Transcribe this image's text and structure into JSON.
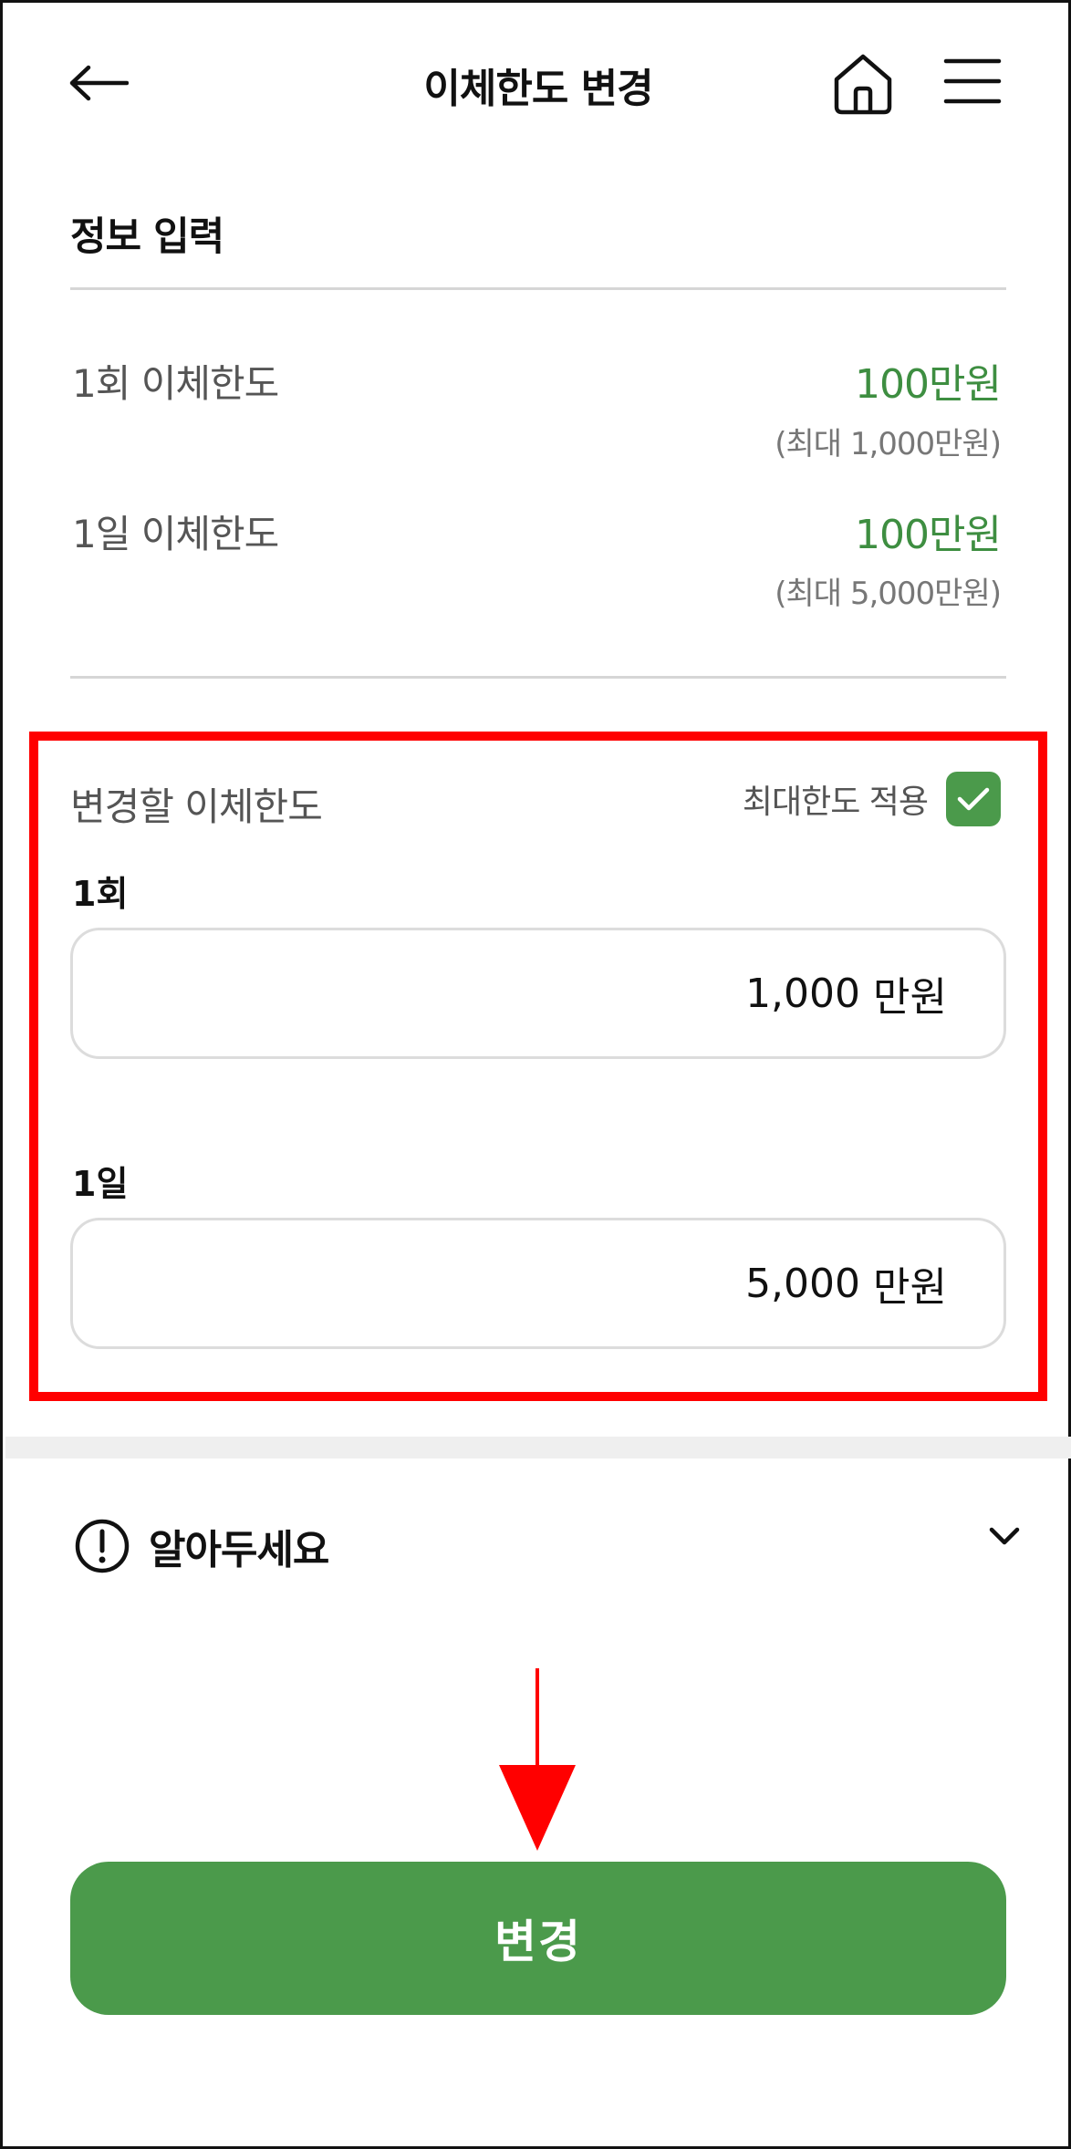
{
  "header": {
    "title": "이체한도 변경",
    "back_icon": "arrow-left-icon",
    "home_icon": "home-icon",
    "menu_icon": "hamburger-menu-icon"
  },
  "info": {
    "section_title": "정보 입력",
    "rows": [
      {
        "label": "1회 이체한도",
        "value": "100만원",
        "sub": "(최대 1,000만원)"
      },
      {
        "label": "1일 이체한도",
        "value": "100만원",
        "sub": "(최대 5,000만원)"
      }
    ]
  },
  "change_limit": {
    "title": "변경할 이체한도",
    "max_apply_label": "최대한도 적용",
    "max_apply_checked": true,
    "fields": [
      {
        "label": "1회",
        "value": "1,000",
        "unit": "만원"
      },
      {
        "label": "1일",
        "value": "5,000",
        "unit": "만원"
      }
    ]
  },
  "notice": {
    "label": "알아두세요",
    "icon": "exclamation-circle-icon",
    "toggle_icon": "chevron-down-icon"
  },
  "submit": {
    "label": "변경"
  },
  "colors": {
    "accent_green": "#4b9a4b",
    "value_green": "#3e8e41",
    "annotation_red": "#ff0000"
  }
}
